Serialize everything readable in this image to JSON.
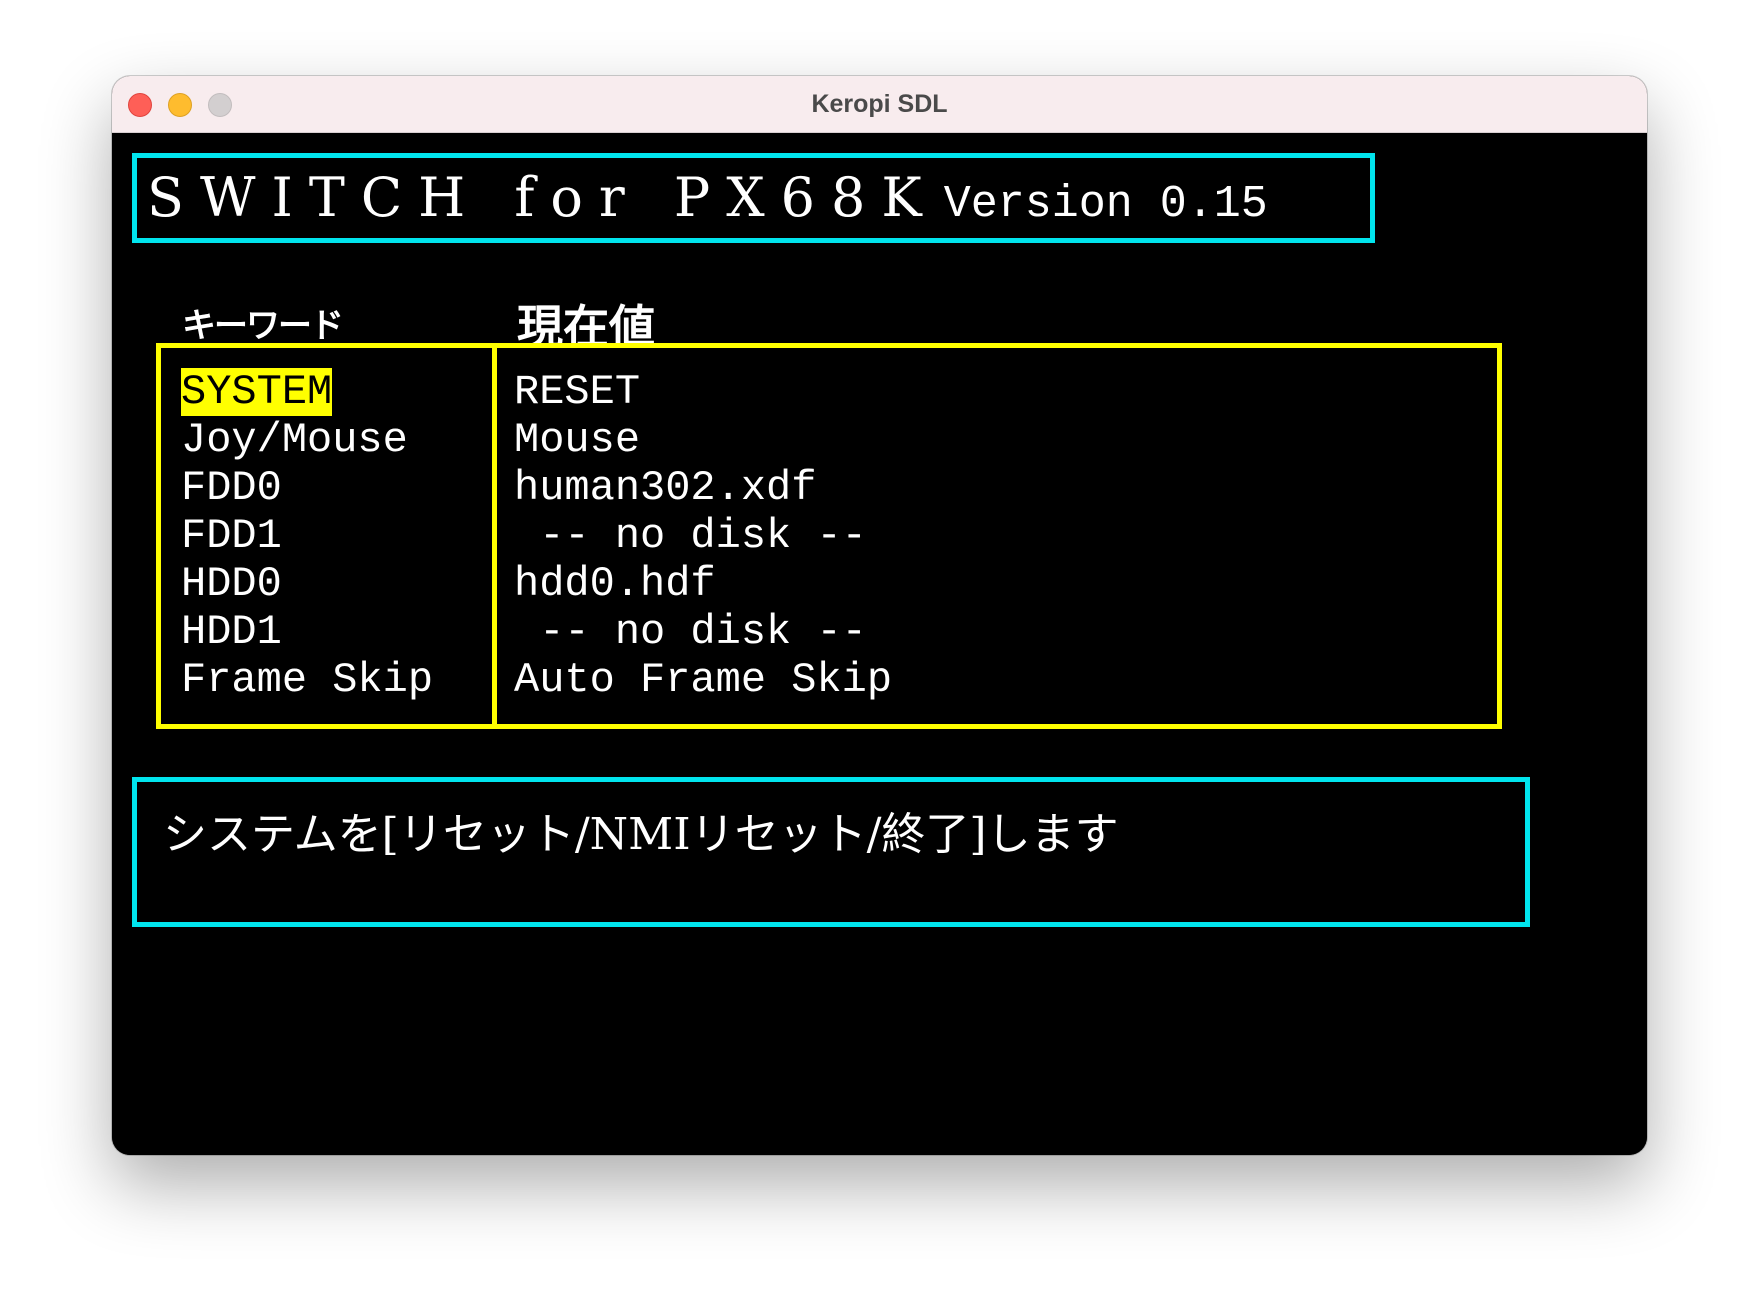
{
  "window": {
    "title": "Keropi SDL"
  },
  "header": {
    "title_main": "SWITCH for PX68K",
    "title_version": "Version 0.15"
  },
  "columns": {
    "keyword": "キーワード",
    "current_value": "現在値"
  },
  "rows": [
    {
      "key": "SYSTEM",
      "value": "RESET",
      "selected": true
    },
    {
      "key": "Joy/Mouse",
      "value": "Mouse",
      "selected": false
    },
    {
      "key": "FDD0",
      "value": "human302.xdf",
      "selected": false
    },
    {
      "key": "FDD1",
      "value": " -- no disk --",
      "selected": false
    },
    {
      "key": "HDD0",
      "value": "hdd0.hdf",
      "selected": false
    },
    {
      "key": "HDD1",
      "value": " -- no disk --",
      "selected": false
    },
    {
      "key": "Frame Skip",
      "value": "Auto Frame Skip",
      "selected": false
    }
  ],
  "message": "システムを[リセット/NMIリセット/終了]します",
  "colors": {
    "border_cyan": "#00e5ee",
    "border_yellow": "#ffff00",
    "selection_bg": "#ffff00",
    "screen_bg": "#000000",
    "text": "#ffffff"
  }
}
